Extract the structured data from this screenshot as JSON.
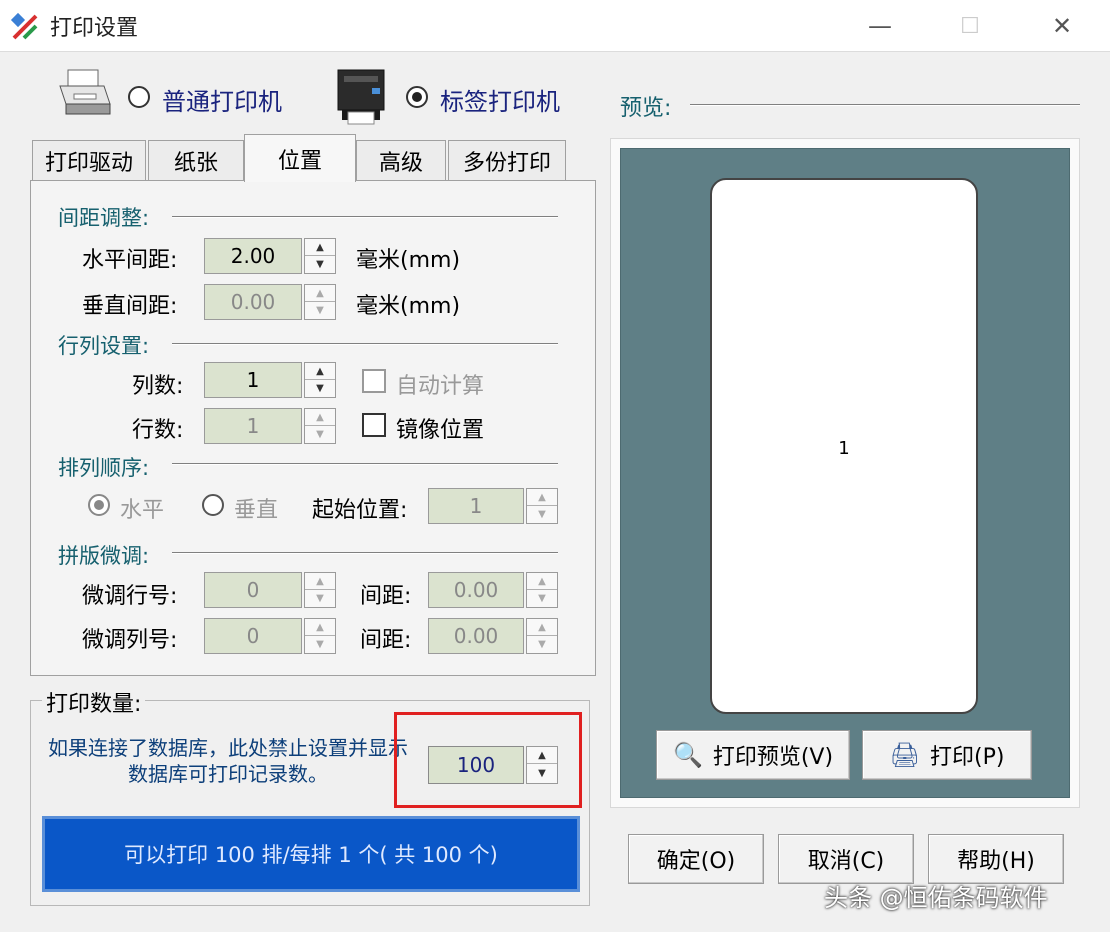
{
  "window": {
    "title": "打印设置",
    "close": "✕",
    "maximize": "☐"
  },
  "printer_types": {
    "normal_label": "普通打印机",
    "label_label": "标签打印机",
    "selected": "label"
  },
  "tabs": [
    "打印驱动",
    "纸张",
    "位置",
    "高级",
    "多份打印"
  ],
  "active_tab": "位置",
  "spacing": {
    "section": "间距调整:",
    "horizontal_label": "水平间距:",
    "horizontal_value": "2.00",
    "vertical_label": "垂直间距:",
    "vertical_value": "0.00",
    "unit": "毫米(mm)"
  },
  "rowcol": {
    "section": "行列设置:",
    "cols_label": "列数:",
    "cols_value": "1",
    "rows_label": "行数:",
    "rows_value": "1",
    "auto_calc": "自动计算",
    "mirror": "镜像位置"
  },
  "order": {
    "section": "排列顺序:",
    "horizontal": "水平",
    "vertical": "垂直",
    "start_label": "起始位置:",
    "start_value": "1"
  },
  "finetune": {
    "section": "拼版微调:",
    "row_label": "微调行号:",
    "row_value": "0",
    "col_label": "微调列号:",
    "col_value": "0",
    "gap_label": "间距:",
    "gap_row_value": "0.00",
    "gap_col_value": "0.00"
  },
  "quantity": {
    "title": "打印数量:",
    "note": "如果连接了数据库，此处禁止设置并显示数据库可打印记录数。",
    "value": "100",
    "summary": "可以打印 100 排/每排 1 个( 共 100 个)"
  },
  "preview": {
    "label": "预览:",
    "page_number": "1",
    "preview_button": "打印预览(V)",
    "print_button": "打印(P)"
  },
  "buttons": {
    "ok": "确定(O)",
    "cancel": "取消(C)",
    "help": "帮助(H)"
  },
  "watermark": "头条 @恒佑条码软件"
}
